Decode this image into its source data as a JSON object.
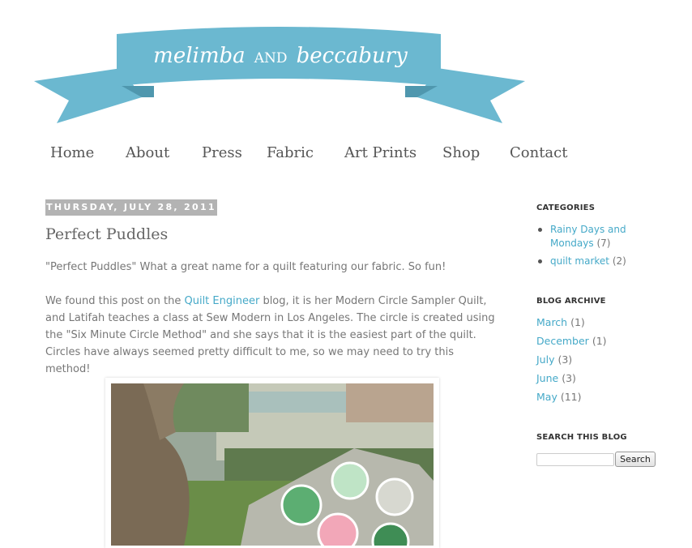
{
  "blog": {
    "title_part1": "melimba",
    "title_part2": "AND",
    "title_part3": "beccabury",
    "banner_color": "#6bb8d0",
    "banner_shadow": "#4f97ae"
  },
  "nav": {
    "items": [
      {
        "label": "Home"
      },
      {
        "label": "About"
      },
      {
        "label": "Press"
      },
      {
        "label": "Fabric"
      },
      {
        "label": "Art Prints"
      },
      {
        "label": "Shop"
      },
      {
        "label": "Contact"
      }
    ]
  },
  "post": {
    "date": "Thursday, July 28, 2011",
    "title": "Perfect Puddles",
    "para1": "\"Perfect Puddles\" What a great name for a quilt featuring our fabric. So fun!",
    "para2_pre": "We found this post on the ",
    "para2_link": "Quilt Engineer",
    "para2_post": " blog, it is her Modern Circle Sampler Quilt, and Latifah teaches a class at Sew Modern in Los Angeles. The circle is created using the \"Six Minute Circle Method\" and she says that it is the easiest part of the quilt. Circles have always seemed pretty difficult to me, so we may need to try this method!"
  },
  "sidebar": {
    "categories_title": "Categories",
    "categories": [
      {
        "label": "Rainy Days and Mondays",
        "count": "(7)"
      },
      {
        "label": "quilt market",
        "count": "(2)"
      }
    ],
    "archive_title": "Blog Archive",
    "archive": [
      {
        "label": "March",
        "count": "(1)"
      },
      {
        "label": "December",
        "count": "(1)"
      },
      {
        "label": "July",
        "count": "(3)"
      },
      {
        "label": "June",
        "count": "(3)"
      },
      {
        "label": "May",
        "count": "(11)"
      }
    ],
    "search_title": "Search This Blog",
    "search_value": "",
    "search_button": "Search"
  },
  "colors": {
    "link": "#45a9c8",
    "date_header_bg": "#b3b3b3"
  },
  "icons": {
    "bullet": "bullet-icon"
  }
}
